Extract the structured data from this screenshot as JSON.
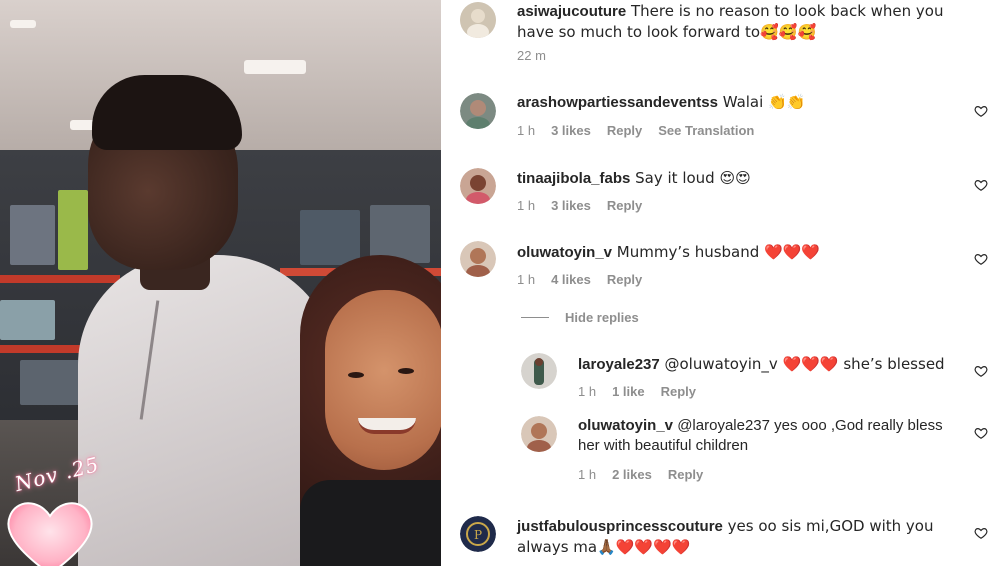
{
  "photo": {
    "date_sticker": "Nov .25",
    "heart_color": "#ff9fb8"
  },
  "comments": [
    {
      "username": "asiwajucouture",
      "text": " There is no reason to look back when you have so much to look forward to🥰🥰🥰",
      "time": "22 m",
      "likes": "",
      "reply": "",
      "see_translation": ""
    },
    {
      "username": "arashowpartiessandeventss",
      "text": " Walai 👏👏",
      "time": "1 h",
      "likes": "3 likes",
      "reply": "Reply",
      "see_translation": "See Translation"
    },
    {
      "username": "tinaajibola_fabs",
      "text": " Say it loud 😍😍",
      "time": "1 h",
      "likes": "3 likes",
      "reply": "Reply"
    },
    {
      "username": "oluwatoyin_v",
      "text": " Mummy’s husband ❤️❤️❤️",
      "time": "1 h",
      "likes": "4 likes",
      "reply": "Reply"
    }
  ],
  "hide_replies": "Hide replies",
  "replies": [
    {
      "username": "laroyale237",
      "text": " @oluwatoyin_v ❤️❤️❤️ she’s blessed",
      "time": "1 h",
      "likes": "1 like",
      "reply": "Reply"
    },
    {
      "username": "oluwatoyin_v",
      "text": " @laroyale237 yes ooo ,God really bless her with beautiful children",
      "time": "1 h",
      "likes": "2 likes",
      "reply": "Reply"
    }
  ],
  "last_comment": {
    "username": "justfabulousprincesscouture",
    "text": " yes oo sis mi,GOD with you always ma🙏🏾❤️❤️❤️❤️"
  },
  "colors": {
    "text": "#262626",
    "meta": "#8e8e8e",
    "heart_icon": "#262626"
  }
}
